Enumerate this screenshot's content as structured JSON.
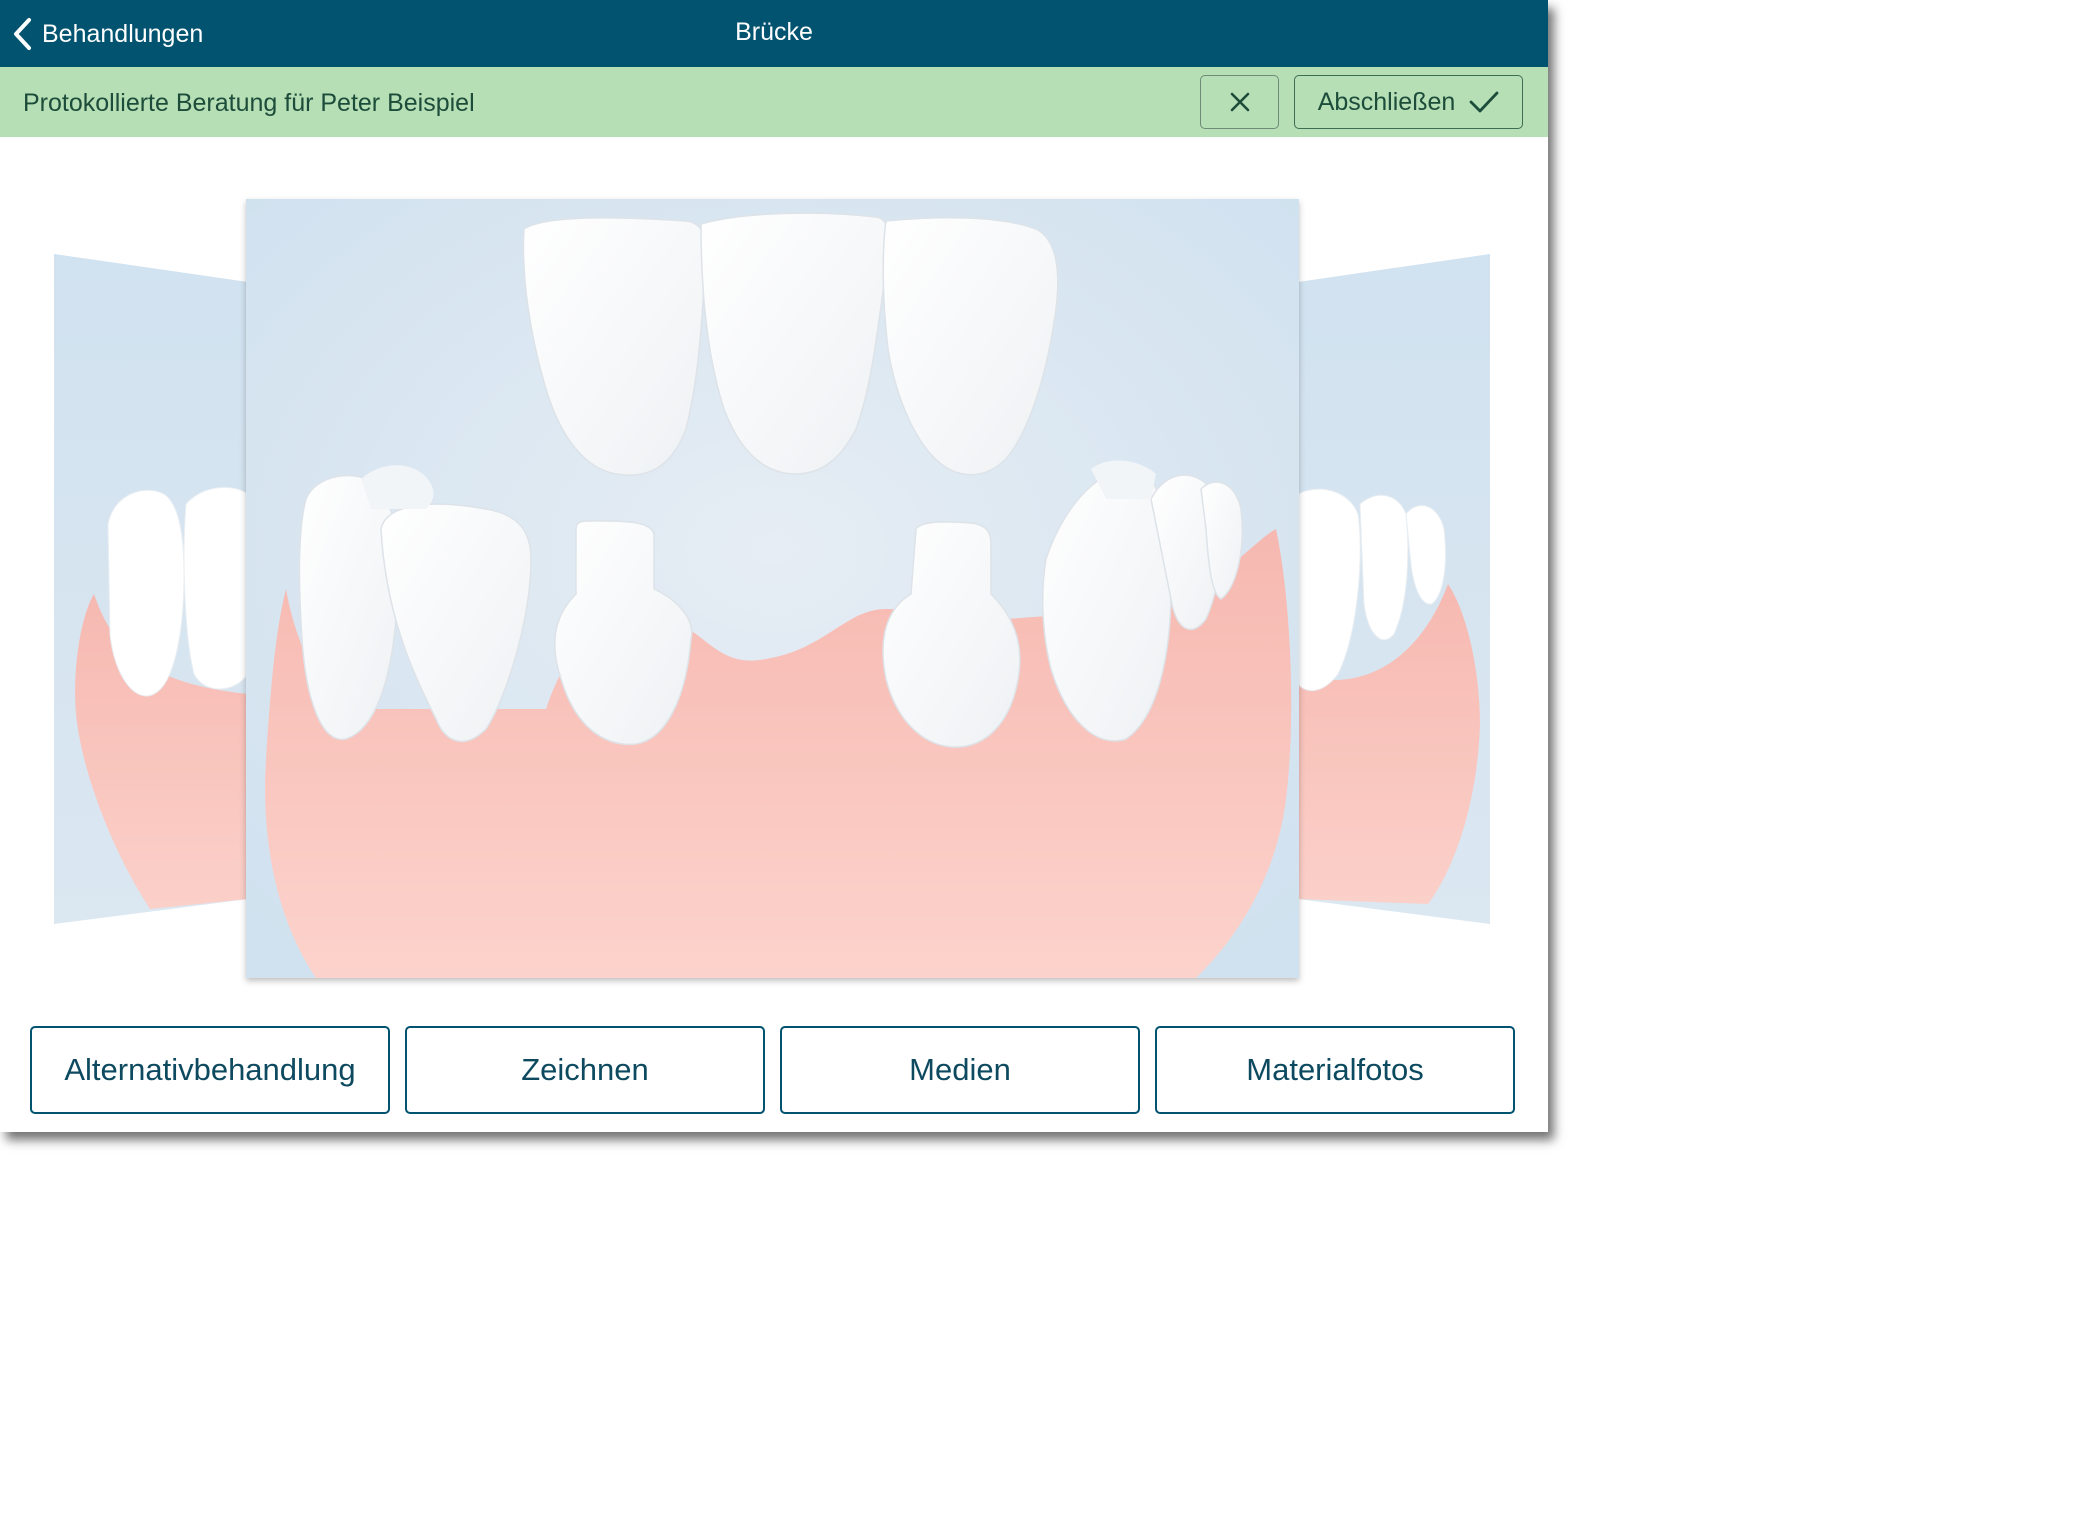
{
  "navbar": {
    "back_label": "Behandlungen",
    "title": "Brücke",
    "background": "#015370"
  },
  "session": {
    "text": "Protokollierte Beratung für Peter Beispiel",
    "cancel_icon": "close-icon",
    "finish_label": "Abschließen",
    "finish_icon": "checkmark-icon",
    "background": "#b6dfb6"
  },
  "carousel": {
    "current_image": "dental-bridge-illustration",
    "previous_image": "dental-illustration-previous",
    "next_image": "dental-illustration-next"
  },
  "actions": [
    {
      "label": "Alternativbehandlung"
    },
    {
      "label": "Zeichnen"
    },
    {
      "label": "Medien"
    },
    {
      "label": "Materialfotos"
    }
  ],
  "colors": {
    "accent": "#015370",
    "gum": "#f9c4bc",
    "background_blue": "#d3e3f0"
  }
}
